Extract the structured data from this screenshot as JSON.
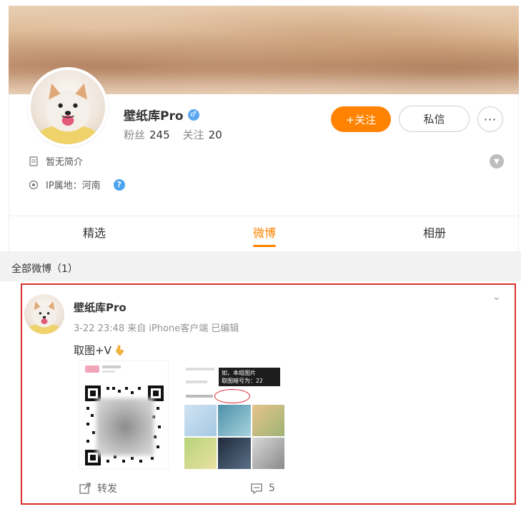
{
  "profile": {
    "nickname": "壁纸库Pro",
    "gender_icon": "male-icon",
    "followers_label": "粉丝",
    "followers_count": "245",
    "following_label": "关注",
    "following_count": "20",
    "follow_button": "+关注",
    "message_button": "私信",
    "more_button": "···",
    "intro_text": "暂无简介",
    "ip_text": "IP属地：河南",
    "help_icon": "?"
  },
  "tabs": [
    {
      "label": "精选",
      "active": false
    },
    {
      "label": "微博",
      "active": true
    },
    {
      "label": "相册",
      "active": false
    }
  ],
  "feed": {
    "filter_label": "全部微博（1）"
  },
  "post": {
    "author": "壁纸库Pro",
    "meta": "3-22 23:48 来自 iPhone客户端 已编辑",
    "text": "取图+V",
    "emoji_icon": "pointing-down-hand-icon",
    "image2_tooltip_line1": "如，本组图片",
    "image2_tooltip_line2": "取图暗号为：22",
    "repost_label": "转发",
    "comment_count": "5"
  },
  "colors": {
    "accent": "#ff8200",
    "highlight_frame": "#d9322b",
    "verify_blue": "#5aa7f0"
  }
}
